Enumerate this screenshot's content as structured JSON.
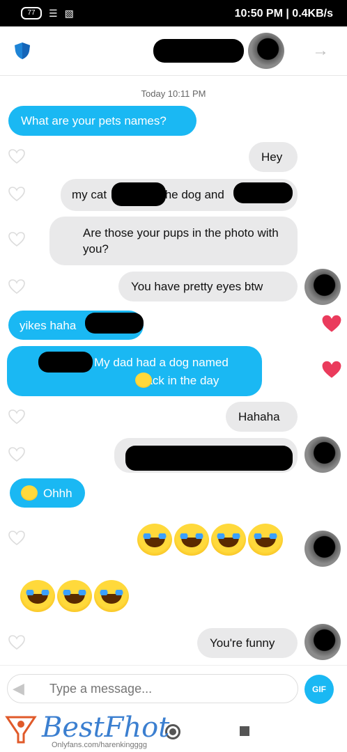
{
  "status_bar": {
    "time_speed": "10:50 PM | 0.4KB/s",
    "battery": "77"
  },
  "header": {
    "shield_icon": "shield-icon",
    "arrow_icon": "arrow-icon"
  },
  "conversation": {
    "timestamp": "Today 10:11 PM",
    "messages": {
      "m1": "What are your pets names?",
      "m2": "Hey",
      "m3_a": "the dog and",
      "m3_b": "my cat",
      "m4": "Are those your pups in the photo with you?",
      "m5": "You have pretty eyes btw",
      "m6": "yikes haha",
      "m7_a": "My dad had a dog named",
      "m7_b": "back in the day",
      "m8": "Hahaha",
      "m10": "Ohhh",
      "m13": "You're funny"
    }
  },
  "composer": {
    "placeholder": "Type a message...",
    "gif_label": "GIF"
  },
  "watermark": {
    "brand": "BestFhot",
    "sub": "Onlyfans.com/harenkingggg"
  },
  "colors": {
    "accent": "#1ab8f3",
    "grey_bubble": "#e9e9ea",
    "heart": "#ea3b5c"
  }
}
